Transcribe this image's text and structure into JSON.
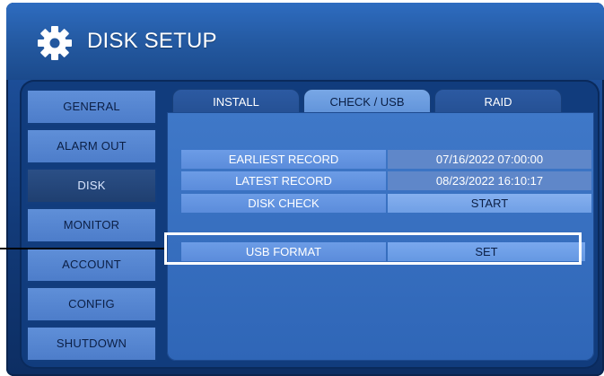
{
  "window": {
    "title": "DISK SETUP",
    "icon": "gear-icon"
  },
  "sidebar": {
    "items": [
      {
        "label": "GENERAL"
      },
      {
        "label": "ALARM OUT"
      },
      {
        "label": "DISK",
        "selected": true
      },
      {
        "label": "MONITOR"
      },
      {
        "label": "ACCOUNT"
      },
      {
        "label": "CONFIG"
      },
      {
        "label": "SHUTDOWN"
      }
    ]
  },
  "tabs": [
    {
      "label": "INSTALL"
    },
    {
      "label": "CHECK / USB",
      "active": true
    },
    {
      "label": "RAID"
    }
  ],
  "rows": {
    "earliest_record": {
      "label": "EARLIEST RECORD",
      "value": "07/16/2022 07:00:00"
    },
    "latest_record": {
      "label": "LATEST RECORD",
      "value": "08/23/2022 16:10:17"
    },
    "disk_check": {
      "label": "DISK CHECK",
      "value": "START"
    },
    "usb_format": {
      "label": "USB FORMAT",
      "value": "SET"
    }
  },
  "colors": {
    "accent": "#2a63b3",
    "panel": "#3f78c8",
    "highlight": "#ffffff"
  }
}
